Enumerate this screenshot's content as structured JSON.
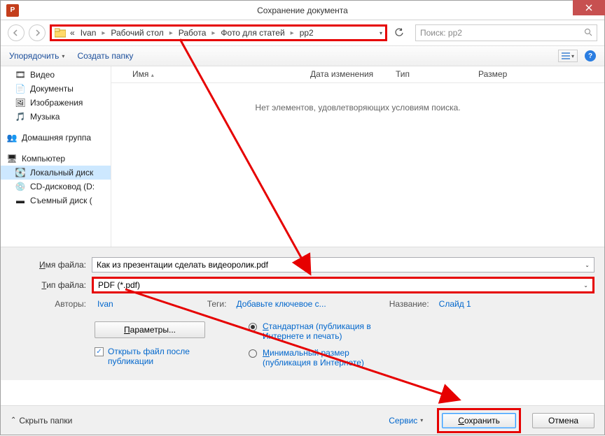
{
  "window": {
    "title": "Сохранение документа"
  },
  "nav": {
    "back": "‹",
    "forward": "›"
  },
  "breadcrumbs": {
    "prefix": "«",
    "items": [
      "Ivan",
      "Рабочий стол",
      "Работа",
      "Фото для статей",
      "pp2"
    ]
  },
  "search": {
    "placeholder": "Поиск: pp2"
  },
  "toolbar": {
    "organize": "Упорядочить",
    "new_folder": "Создать папку"
  },
  "sidebar": {
    "libs": [
      {
        "icon": "🎞",
        "label": "Видео"
      },
      {
        "icon": "📄",
        "label": "Документы"
      },
      {
        "icon": "🖼",
        "label": "Изображения"
      },
      {
        "icon": "🎵",
        "label": "Музыка"
      }
    ],
    "homegroup": {
      "icon": "👥",
      "label": "Домашняя группа"
    },
    "computer_label": "Компьютер",
    "drives": [
      {
        "icon": "💽",
        "label": "Локальный диск"
      },
      {
        "icon": "💿",
        "label": "CD-дисковод (D:"
      },
      {
        "icon": "▬",
        "label": "Съемный диск ("
      }
    ]
  },
  "columns": {
    "name": "Имя",
    "date": "Дата изменения",
    "type": "Тип",
    "size": "Размер"
  },
  "list": {
    "empty": "Нет элементов, удовлетворяющих условиям поиска."
  },
  "filename": {
    "label": "Имя файла:",
    "value": "Как из презентации сделать видеоролик.pdf"
  },
  "filetype": {
    "label": "Тип файла:",
    "value": "PDF (*.pdf)"
  },
  "meta": {
    "authors_label": "Авторы:",
    "authors_value": "Ivan",
    "tags_label": "Теги:",
    "tags_value": "Добавьте ключевое с...",
    "title_label": "Название:",
    "title_value": "Слайд 1"
  },
  "options": {
    "params_btn": "Параметры...",
    "open_after": "Открыть файл после публикации",
    "opt_standard": "Стандартная (публикация в Интернете и печать)",
    "opt_minimal": "Минимальный размер (публикация в Интернете)"
  },
  "footer": {
    "hide_folders": "Скрыть папки",
    "tools": "Сервис",
    "save": "Сохранить",
    "cancel": "Отмена"
  }
}
